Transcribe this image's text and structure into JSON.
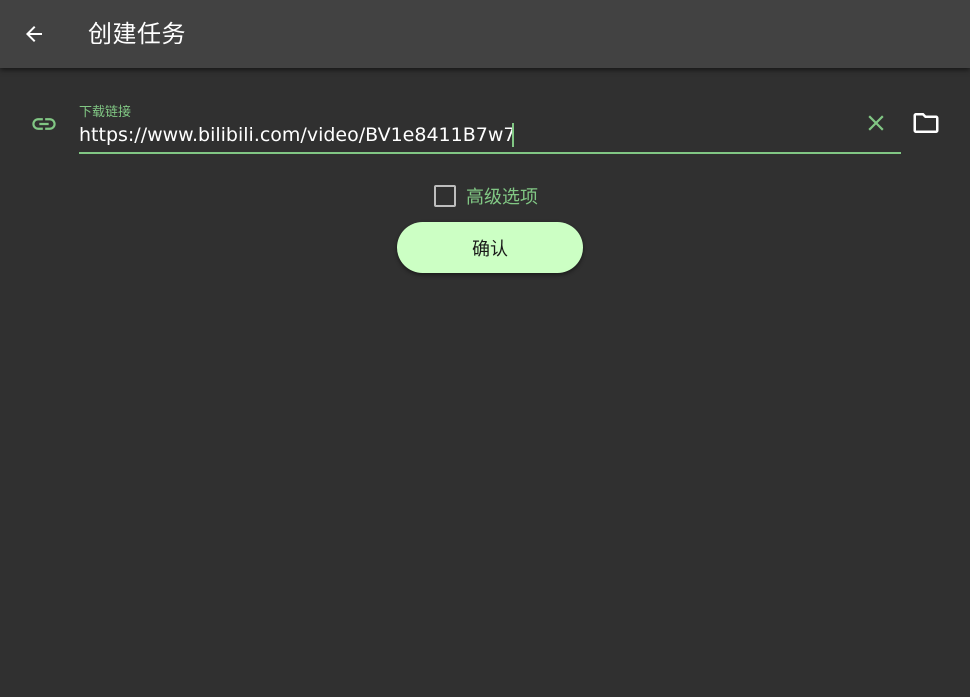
{
  "appbar": {
    "title": "创建任务",
    "back_icon": "arrow-back-icon"
  },
  "url_field": {
    "label": "下载链接",
    "value": "https://www.bilibili.com/video/BV1e8411B7w7",
    "leading_icon": "link-icon",
    "clear_icon": "close-icon",
    "folder_icon": "folder-icon"
  },
  "advanced": {
    "label": "高级选项",
    "checked": false
  },
  "confirm": {
    "label": "确认"
  },
  "colors": {
    "background": "#303030",
    "appbar": "#424242",
    "accent": "#81c784",
    "button": "#ccffc4"
  }
}
